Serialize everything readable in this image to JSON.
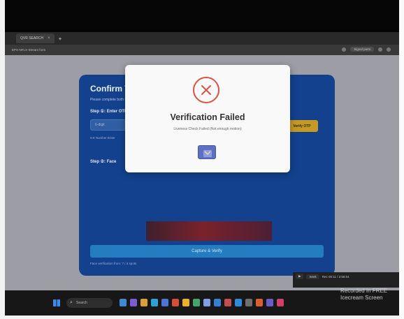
{
  "browser": {
    "tab_label": "QVR SEARCH",
    "tab_close": "×",
    "new_tab": "+",
    "url": "EPX-NFLX-Stream form",
    "profile_label": "Signal parts",
    "icons": [
      "star-icon",
      "extensions-icon",
      "menu-icon"
    ]
  },
  "card": {
    "title": "Confirm Transaction",
    "subtitle": "Please complete both steps to verify your identity and proceed securely.",
    "step1_label": "Step ①: Enter OTP",
    "otp_placeholder": "6-digit",
    "verify_otp_label": "Verify OTP",
    "help_text": "6-8 Number Enter",
    "step2_label": "Step ②: Face",
    "action_button_label": "Capture & Verify",
    "footer_text": "Face verification from: 7 / 4 spots"
  },
  "modal": {
    "icon": "error-x-icon",
    "title": "Verification Failed",
    "message": "Liveness Check Failed (Not enough motion)",
    "ok_icon": "ok-button-icon"
  },
  "notification": {
    "btn1": "▶",
    "btn2": "Seek",
    "status": "Rec 00:11 / 2:56:04"
  },
  "watermark": {
    "line1": "Recorded In FREE",
    "line2": "Icecream Screen"
  },
  "taskbar": {
    "search_label": "Search",
    "apps": [
      {
        "name": "app-widgets-icon",
        "color": "#3a8ad8"
      },
      {
        "name": "app-chat-icon",
        "color": "#7b5bd6"
      },
      {
        "name": "app-explorer-icon",
        "color": "#e0a331"
      },
      {
        "name": "app-edge-icon",
        "color": "#2aa3d6"
      },
      {
        "name": "app-store-icon",
        "color": "#4b73d9"
      },
      {
        "name": "app-chrome-icon",
        "color": "#d84a3a"
      },
      {
        "name": "app-folder-icon",
        "color": "#f0b429"
      },
      {
        "name": "app-photos-icon",
        "color": "#3fa66a"
      },
      {
        "name": "app-settings-icon",
        "color": "#7fa3e8"
      },
      {
        "name": "app-mail-icon",
        "color": "#2f7fd6"
      },
      {
        "name": "app-camera-icon",
        "color": "#c84b4b"
      },
      {
        "name": "app-vscode-icon",
        "color": "#2b8be0"
      },
      {
        "name": "app-terminal-icon",
        "color": "#6e6e6e"
      },
      {
        "name": "app-office-icon",
        "color": "#e05d2a"
      },
      {
        "name": "app-teams-icon",
        "color": "#6a5acd"
      },
      {
        "name": "app-recorder-icon",
        "color": "#d33d6a"
      }
    ]
  },
  "colors": {
    "card_blue": "#0d3e8f",
    "error_red": "#e0513d",
    "verify_gold": "#c99a1f",
    "action_blue": "#1f7cc4"
  }
}
